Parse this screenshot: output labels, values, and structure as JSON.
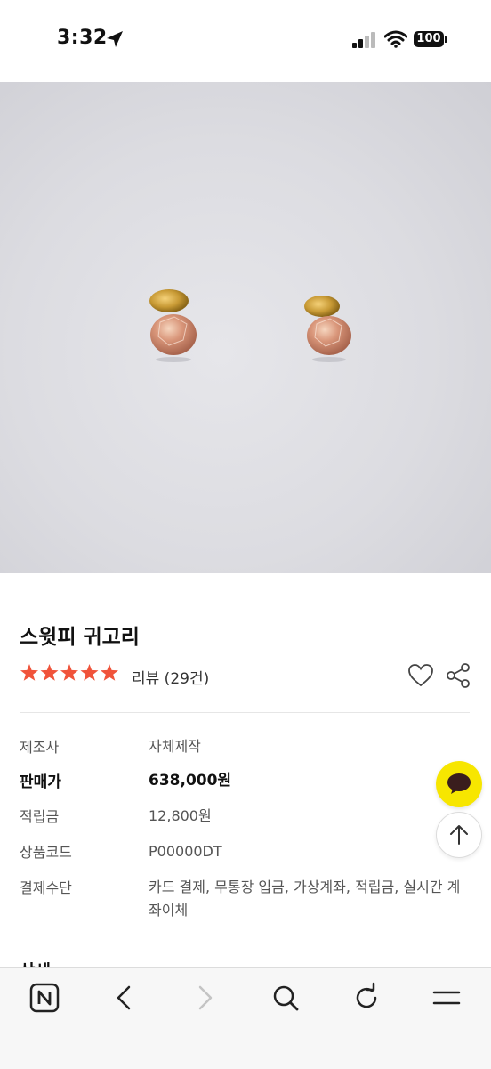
{
  "status_bar": {
    "time": "3:32",
    "battery": "100"
  },
  "product": {
    "title": "스윗피 귀고리",
    "rating_stars": 5,
    "review_text": "리뷰 (29건)"
  },
  "info_rows": [
    {
      "label": "제조사",
      "value": "자체제작"
    },
    {
      "label": "판매가",
      "value": "638,000원"
    },
    {
      "label": "적립금",
      "value": "12,800원"
    },
    {
      "label": "상품코드",
      "value": "P00000DT"
    },
    {
      "label": "결제수단",
      "value": "카드 결제, 무통장 입금, 가상계좌, 적립금, 실시간 계좌이체"
    }
  ],
  "next_section_heading": "상세",
  "colors": {
    "star": "#f0533a",
    "kakao": "#f7e600",
    "text": "#111111"
  },
  "icons": {
    "heart": "heart-icon",
    "share": "share-icon",
    "kakao": "chat-bubble-icon",
    "top": "arrow-up-icon",
    "home": "naver-n-icon",
    "back": "chevron-left-icon",
    "forward": "chevron-right-icon",
    "search": "search-icon",
    "reload": "reload-icon",
    "menu": "menu-icon"
  }
}
